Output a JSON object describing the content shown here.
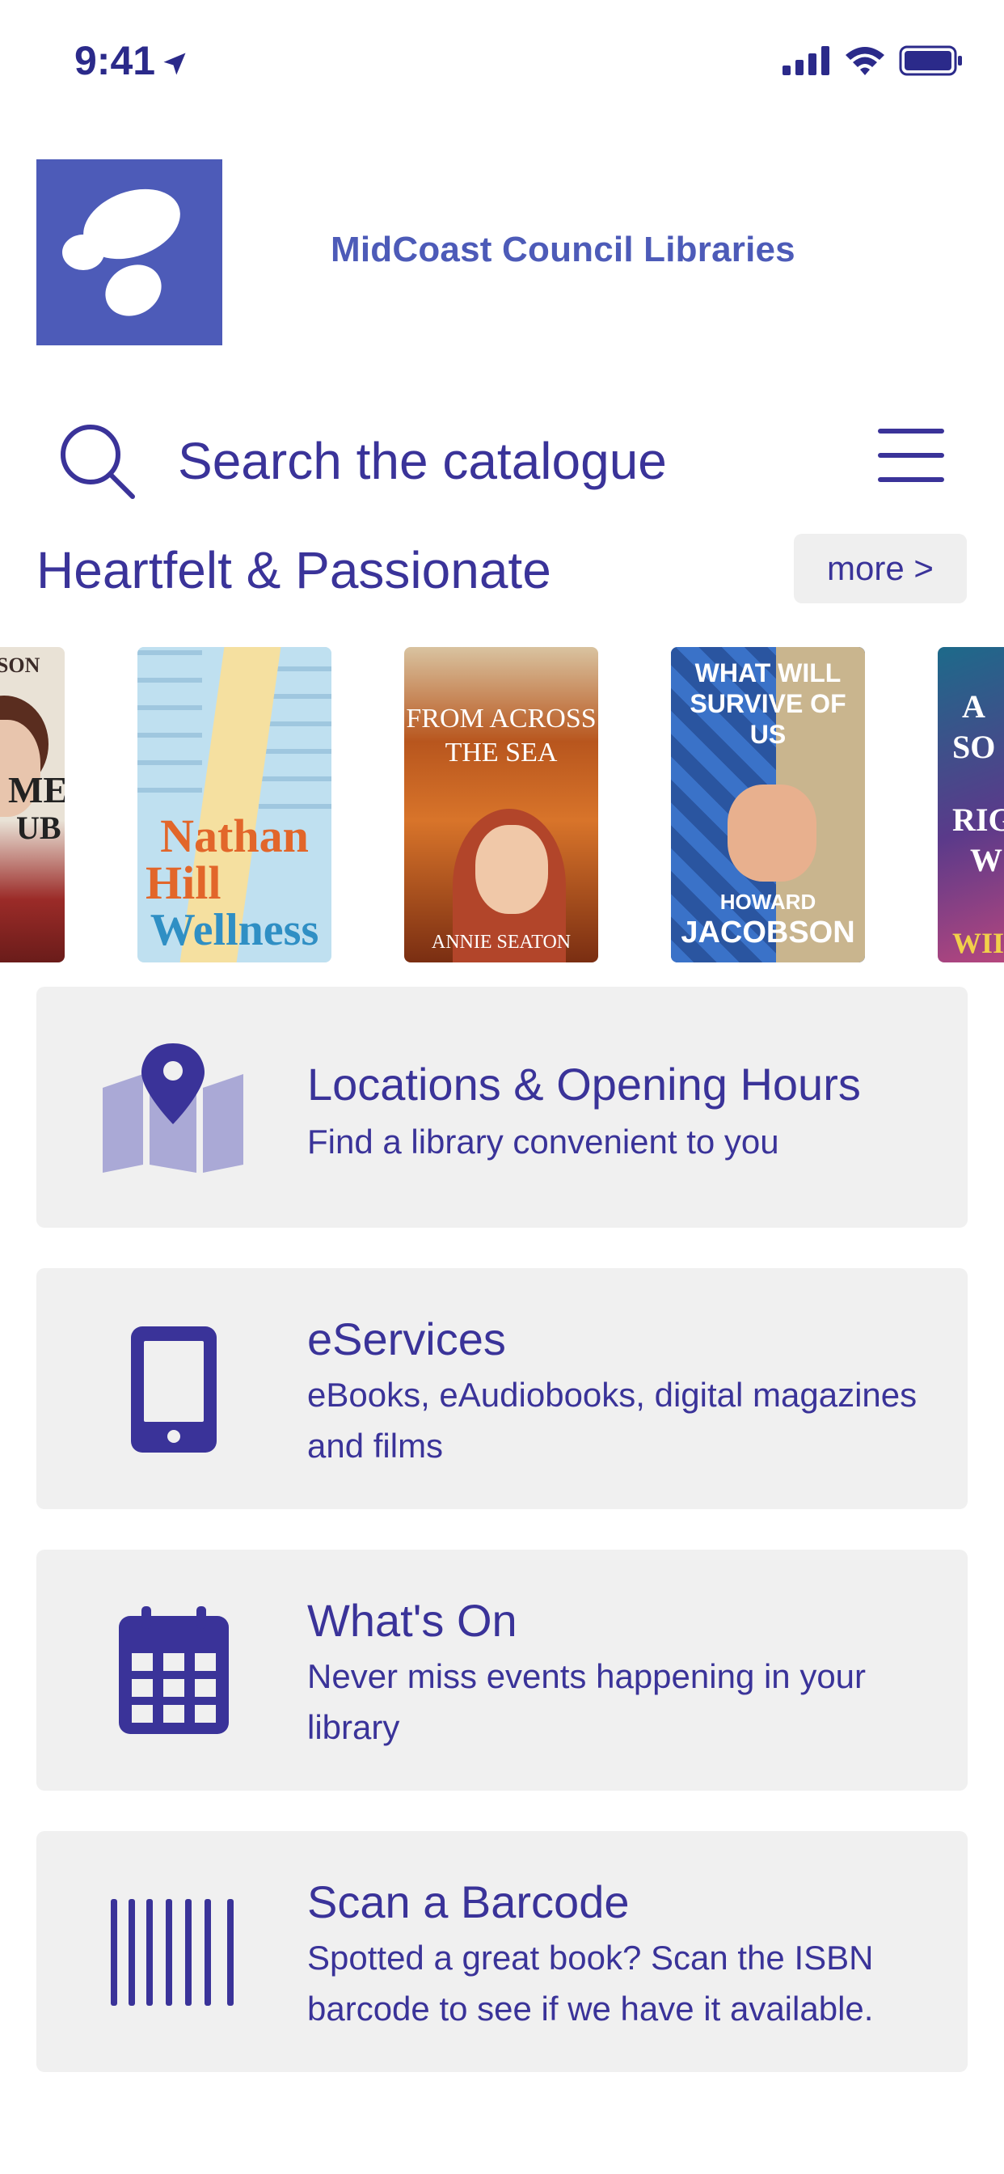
{
  "status_bar": {
    "time": "9:41"
  },
  "header": {
    "brand_name": "MidCoast Council Libraries",
    "accent_color": "#4d5bb8"
  },
  "search": {
    "placeholder": "Search the catalogue"
  },
  "carousel": {
    "title": "Heartfelt & Passionate",
    "more_label": "more >",
    "books": [
      {
        "cover_text": [
          "PSON",
          "ME",
          "UB"
        ]
      },
      {
        "cover_text": [
          "Nathan",
          "Hill",
          "Wellness"
        ]
      },
      {
        "cover_text": [
          "FROM ACROSS",
          "THE SEA",
          "ANNIE SEATON"
        ]
      },
      {
        "cover_text": [
          "WHAT WILL",
          "SURVIVE OF",
          "US",
          "HOWARD",
          "JACOBSON"
        ]
      },
      {
        "cover_text": [
          "A",
          "SO",
          "RIG",
          "W",
          "WII"
        ]
      }
    ]
  },
  "menu": [
    {
      "title": "Locations & Opening Hours",
      "subtitle": "Find a library convenient to you",
      "icon": "map-pin-icon"
    },
    {
      "title": "eServices",
      "subtitle": "eBooks, eAudiobooks, digital magazines and films",
      "icon": "tablet-icon"
    },
    {
      "title": "What's On",
      "subtitle": "Never miss events happening in your library",
      "icon": "calendar-icon"
    },
    {
      "title": "Scan a Barcode",
      "subtitle": "Spotted a great book? Scan the ISBN barcode to see if we have it available.",
      "icon": "barcode-icon"
    }
  ]
}
